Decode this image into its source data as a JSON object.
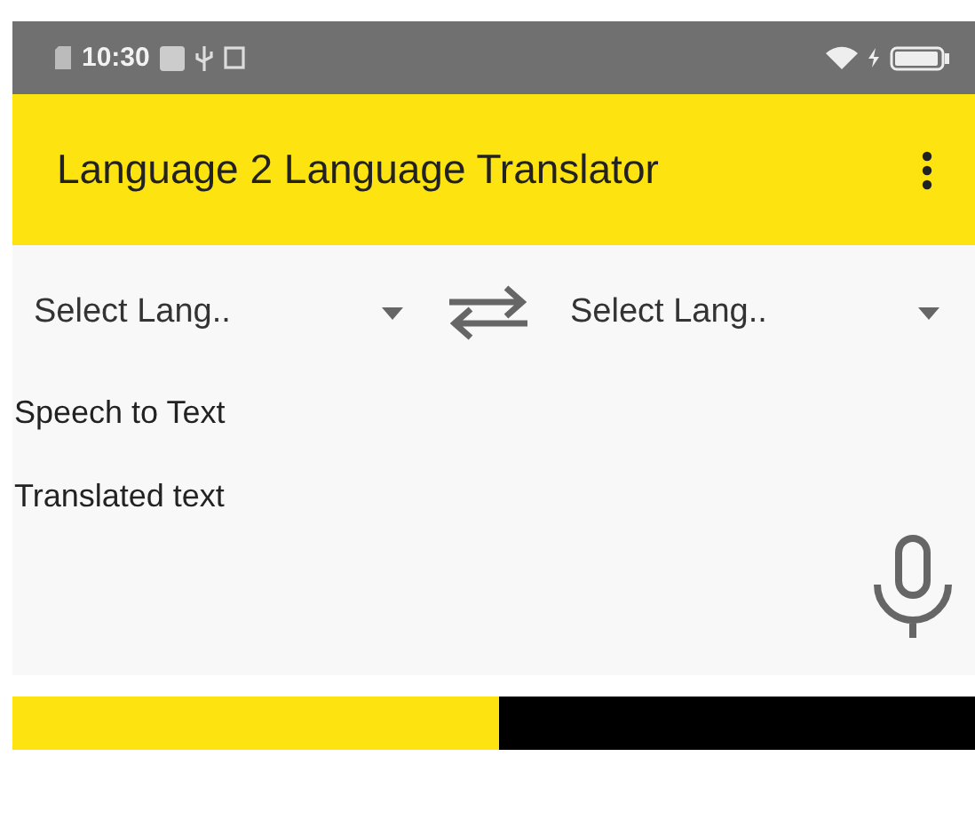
{
  "status_bar": {
    "time": "10:30"
  },
  "app_bar": {
    "title": "Language 2 Language Translator"
  },
  "language_selectors": [
    {
      "label": "Select Lang.."
    },
    {
      "label": "Select Lang.."
    }
  ],
  "speech_label": "Speech to Text",
  "translated_label": "Translated text",
  "progress": {
    "level": 0.505
  }
}
